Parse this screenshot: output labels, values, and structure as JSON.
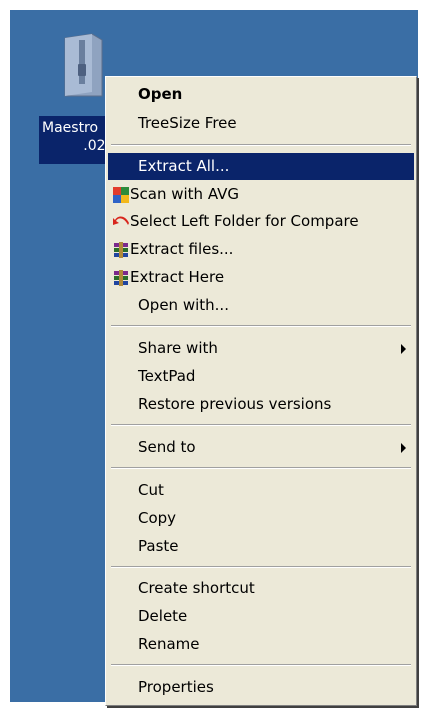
{
  "desktop": {
    "icon": {
      "name": "zip-folder-icon",
      "label_line1": "Maestro",
      "label_line2": ".02."
    }
  },
  "menu": {
    "items": [
      {
        "label": "Open",
        "bold": true
      },
      {
        "label": "TreeSize Free"
      },
      {
        "label": "Extract All...",
        "selected": true
      },
      {
        "label": "Scan with AVG",
        "icon": "avg-icon"
      },
      {
        "label": "Select Left Folder for Compare",
        "icon": "compare-arrow-icon"
      },
      {
        "label": "Extract files...",
        "icon": "winrar-icon"
      },
      {
        "label": "Extract Here",
        "icon": "winrar-icon"
      },
      {
        "label": "Open with..."
      },
      {
        "label": "Share with",
        "submenu": true
      },
      {
        "label": "TextPad"
      },
      {
        "label": "Restore previous versions"
      },
      {
        "label": "Send to",
        "submenu": true
      },
      {
        "label": "Cut"
      },
      {
        "label": "Copy"
      },
      {
        "label": "Paste"
      },
      {
        "label": "Create shortcut"
      },
      {
        "label": "Delete"
      },
      {
        "label": "Rename"
      },
      {
        "label": "Properties"
      }
    ]
  },
  "colors": {
    "desktop": "#3a6ea5",
    "menu_bg": "#ece9d8",
    "highlight": "#0a246a"
  }
}
